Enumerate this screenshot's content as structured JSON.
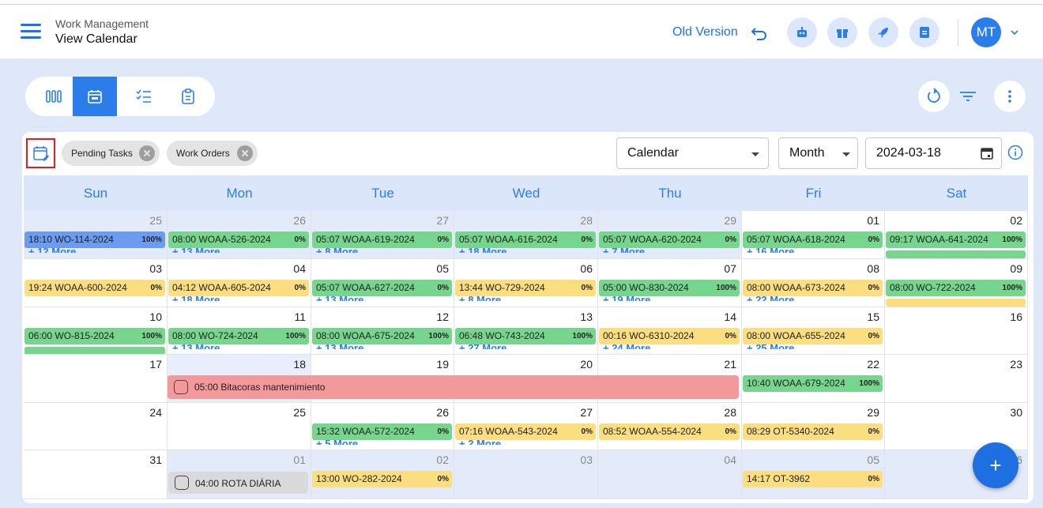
{
  "header": {
    "app_title": "Work Management",
    "page_title": "View Calendar",
    "old_version_label": "Old Version",
    "avatar_initials": "MT"
  },
  "icons": {
    "header_buttons": [
      "robot-icon",
      "gift-icon",
      "rocket-icon",
      "document-icon"
    ],
    "view_tabs": [
      "kanban-icon",
      "calendar-icon",
      "checklist-icon",
      "clipboard-icon"
    ]
  },
  "filters": {
    "chips": [
      "Pending Tasks",
      "Work Orders"
    ],
    "source_select": "Calendar",
    "range_select": "Month",
    "date_value": "2024-03-18"
  },
  "colors": {
    "accent": "#2b7de9",
    "event_green": "#77d68d",
    "event_yellow": "#fbde7f",
    "event_blue": "#6c9cf1",
    "event_red": "#f4999b",
    "event_gray": "#dadada"
  },
  "calendar": {
    "weekdays": [
      "Sun",
      "Mon",
      "Tue",
      "Wed",
      "Thu",
      "Fri",
      "Sat"
    ],
    "weeks": [
      {
        "days": [
          {
            "n": "25",
            "other": true,
            "ev": "18:10 WO-114-2024",
            "pct": "100%",
            "c": "blue",
            "more": "+ 12 More"
          },
          {
            "n": "26",
            "other": true,
            "ev": "08:00 WOAA-526-2024",
            "pct": "0%",
            "c": "green",
            "more": "+ 13 More"
          },
          {
            "n": "27",
            "other": true,
            "ev": "05:07 WOAA-619-2024",
            "pct": "0%",
            "c": "green",
            "more": "+ 8 More"
          },
          {
            "n": "28",
            "other": true,
            "ev": "05:07 WOAA-616-2024",
            "pct": "0%",
            "c": "green",
            "more": "+ 18 More"
          },
          {
            "n": "29",
            "other": true,
            "ev": "05:07 WOAA-620-2024",
            "pct": "0%",
            "c": "green",
            "more": "+ 7 More"
          },
          {
            "n": "01",
            "ev": "05:07 WOAA-618-2024",
            "pct": "0%",
            "c": "green",
            "more": "+ 16 More"
          },
          {
            "n": "02",
            "ev": "09:17 WOAA-641-2024",
            "pct": "100%",
            "c": "green",
            "peek": "green"
          }
        ]
      },
      {
        "days": [
          {
            "n": "03",
            "ev": "19:24 WOAA-600-2024",
            "pct": "0%",
            "c": "yellow"
          },
          {
            "n": "04",
            "ev": "04:12 WOAA-605-2024",
            "pct": "0%",
            "c": "yellow",
            "more": "+ 18 More"
          },
          {
            "n": "05",
            "ev": "05:07 WOAA-627-2024",
            "pct": "0%",
            "c": "green",
            "more": "+ 13 More"
          },
          {
            "n": "06",
            "ev": "13:44 WO-729-2024",
            "pct": "0%",
            "c": "yellow",
            "more": "+ 8 More"
          },
          {
            "n": "07",
            "ev": "05:00 WO-830-2024",
            "pct": "100%",
            "c": "green",
            "more": "+ 19 More"
          },
          {
            "n": "08",
            "ev": "08:00 WOAA-673-2024",
            "pct": "0%",
            "c": "yellow",
            "more": "+ 22 More"
          },
          {
            "n": "09",
            "ev": "08:00 WO-722-2024",
            "pct": "100%",
            "c": "green",
            "peek": "yellow"
          }
        ]
      },
      {
        "days": [
          {
            "n": "10",
            "ev": "06:00 WO-815-2024",
            "pct": "100%",
            "c": "green",
            "peek": "green"
          },
          {
            "n": "11",
            "ev": "08:00 WO-724-2024",
            "pct": "100%",
            "c": "green",
            "more": "+ 13 More"
          },
          {
            "n": "12",
            "ev": "08:00 WOAA-675-2024",
            "pct": "100%",
            "c": "green",
            "more": "+ 13 More"
          },
          {
            "n": "13",
            "ev": "06:48 WO-743-2024",
            "pct": "100%",
            "c": "green",
            "more": "+ 27 More"
          },
          {
            "n": "14",
            "ev": "00:16 WO-6310-2024",
            "pct": "0%",
            "c": "yellow",
            "more": "+ 24 More"
          },
          {
            "n": "15",
            "ev": "08:00 WOAA-655-2024",
            "pct": "0%",
            "c": "yellow",
            "more": "+ 25 More"
          },
          {
            "n": "16"
          }
        ]
      },
      {
        "days": [
          {
            "n": "17"
          },
          {
            "n": "18",
            "today": true
          },
          {
            "n": "19"
          },
          {
            "n": "20"
          },
          {
            "n": "21"
          },
          {
            "n": "22",
            "ev": "10:40 WOAA-679-2024",
            "pct": "100%",
            "c": "green"
          },
          {
            "n": "23"
          }
        ]
      },
      {
        "days": [
          {
            "n": "24"
          },
          {
            "n": "25"
          },
          {
            "n": "26",
            "ev": "15:32 WOAA-572-2024",
            "pct": "0%",
            "c": "green",
            "more": "+ 5 More"
          },
          {
            "n": "27",
            "ev": "07:16 WOAA-543-2024",
            "pct": "0%",
            "c": "yellow",
            "more": "+ 2 More"
          },
          {
            "n": "28",
            "ev": "08:52 WOAA-554-2024",
            "pct": "0%",
            "c": "yellow"
          },
          {
            "n": "29",
            "ev": "08:29 OT-5340-2024",
            "pct": "0%",
            "c": "yellow"
          },
          {
            "n": "30"
          }
        ]
      },
      {
        "days": [
          {
            "n": "31"
          },
          {
            "n": "01",
            "other": true
          },
          {
            "n": "02",
            "other": true,
            "ev": "13:00 WO-282-2024",
            "pct": "0%",
            "c": "yellow"
          },
          {
            "n": "03",
            "other": true
          },
          {
            "n": "04",
            "other": true
          },
          {
            "n": "05",
            "other": true,
            "ev": "14:17 OT-3962",
            "pct": "0%",
            "c": "yellow"
          },
          {
            "n": "06",
            "other": true
          }
        ]
      }
    ],
    "span_event": "05:00 Bitacoras mantenimiento",
    "rota_event": "04:00 ROTA DIÁRIA"
  },
  "fab_label": "+"
}
